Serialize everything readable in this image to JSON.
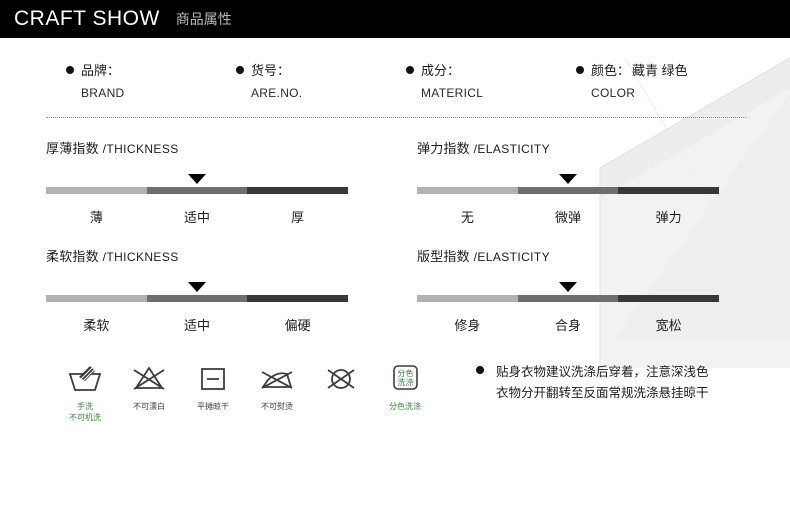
{
  "header": {
    "title": "CRAFT SHOW",
    "subtitle": "商品属性"
  },
  "attributes": [
    {
      "label": "品牌：",
      "en": "BRAND",
      "value": ""
    },
    {
      "label": "货号：",
      "en": "ARE.NO.",
      "value": ""
    },
    {
      "label": "成分：",
      "en": "MATERICL",
      "value": ""
    },
    {
      "label": "颜色：",
      "en": "COLOR",
      "value": "藏青 绿色"
    }
  ],
  "indexes": [
    {
      "title_cn": "厚薄指数",
      "title_en": "/THICKNESS",
      "labels": [
        "薄",
        "适中",
        "厚"
      ],
      "selected": 1
    },
    {
      "title_cn": "弹力指数",
      "title_en": "/ELASTICITY",
      "labels": [
        "无",
        "微弹",
        "弹力"
      ],
      "selected": 1
    },
    {
      "title_cn": "柔软指数",
      "title_en": "/THICKNESS",
      "labels": [
        "柔软",
        "适中",
        "偏硬"
      ],
      "selected": 1
    },
    {
      "title_cn": "版型指数",
      "title_en": "/ELASTICITY",
      "labels": [
        "修身",
        "合身",
        "宽松"
      ],
      "selected": 1
    }
  ],
  "care": {
    "icons": [
      {
        "icon": "hand-wash-icon",
        "label": "手洗\n不可机洗",
        "green": true
      },
      {
        "icon": "no-bleach-icon",
        "label": "不可漂白",
        "green": false
      },
      {
        "icon": "flat-dry-icon",
        "label": "平摊晾干",
        "green": false
      },
      {
        "icon": "no-iron-icon",
        "label": "不可熨烫",
        "green": false
      },
      {
        "icon": "no-dry-clean-icon",
        "label": "",
        "green": false
      },
      {
        "icon": "wash-separately-icon",
        "label": "分色洗涤",
        "green": true
      }
    ],
    "separate_wash_badge": {
      "line1": "分色",
      "line2": "洗涤"
    },
    "note_line1": "贴身衣物建议洗涤后穿着，注意深浅色",
    "note_line2": "衣物分开翻转至反面常规洗涤悬挂晾干"
  },
  "colors": {
    "header_bg": "#000000",
    "bar_light": "#b2b2b2",
    "bar_mid": "#6e6e6e",
    "bar_dark": "#383838",
    "green": "#3a8a3a"
  }
}
